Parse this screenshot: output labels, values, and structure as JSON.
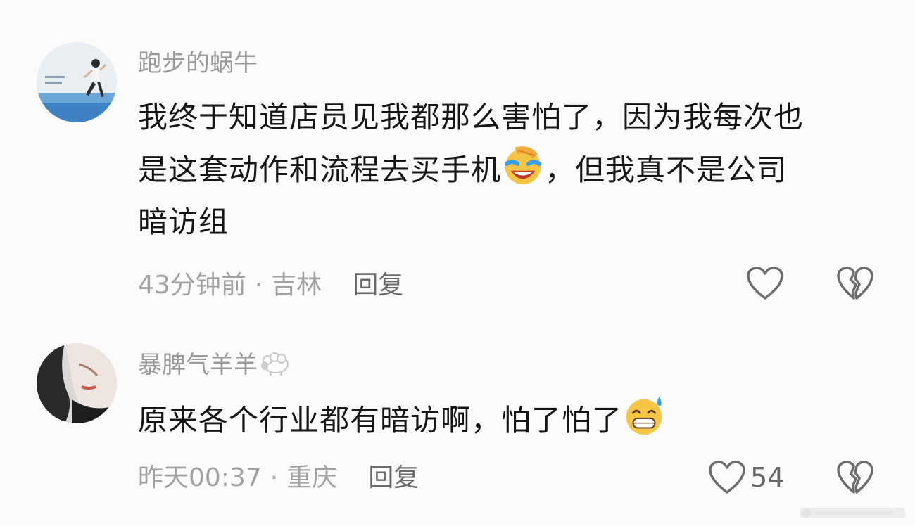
{
  "comments": [
    {
      "username": "跑步的蜗牛",
      "text_lines": [
        "我终于知道店员见我都那么害怕了，因为我每次也",
        "是这套动作和流程去买手机",
        "，但我真不是公司",
        "暗访组"
      ],
      "emoji": "face-palm-laughing-emoji",
      "time": "43分钟前",
      "location": "吉林",
      "separator": "·",
      "reply_label": "回复",
      "like_count": ""
    },
    {
      "username": "暴脾气羊羊",
      "username_badge": "sheep-emoji",
      "text_lines": [
        "原来各个行业都有暗访啊，怕了怕了"
      ],
      "emoji": "grinning-sweat-emoji",
      "time": "昨天00:37",
      "location": "重庆",
      "separator": "·",
      "reply_label": "回复",
      "like_count": "54"
    }
  ],
  "colors": {
    "background": "#fbfbfb",
    "username": "#9a9a9a",
    "text": "#161616",
    "meta": "#a2a2a2",
    "icon": "#6d6d6d"
  }
}
